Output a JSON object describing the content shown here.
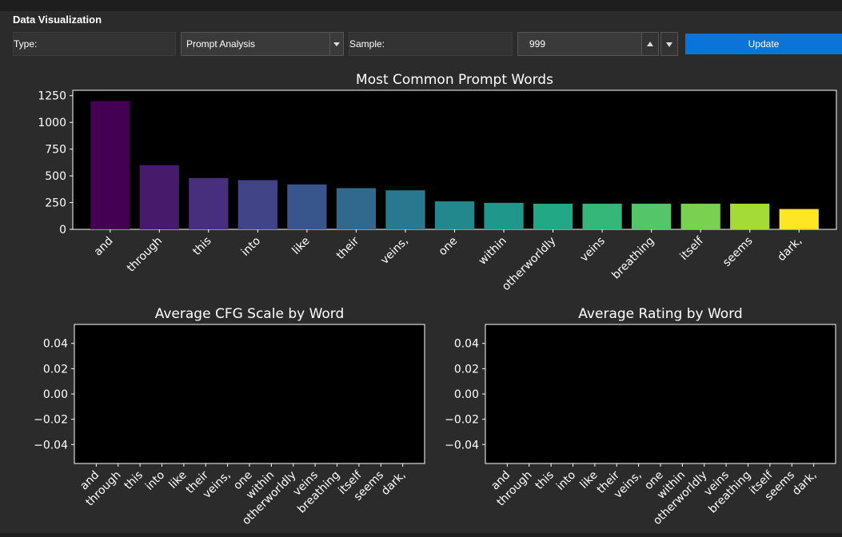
{
  "header": {
    "title": "Data Visualization"
  },
  "toolbar": {
    "type_label": "Type:",
    "type_value": "Prompt Analysis",
    "sample_label": "Sample:",
    "sample_value": "999",
    "update_label": "Update"
  },
  "chart_data": [
    {
      "type": "bar",
      "title": "Most Common Prompt Words",
      "categories": [
        "and",
        "through",
        "this",
        "into",
        "like",
        "their",
        "veins,",
        "one",
        "within",
        "otherworldly",
        "veins",
        "breathing",
        "itself",
        "seems",
        "dark,"
      ],
      "values": [
        1200,
        600,
        480,
        460,
        420,
        385,
        365,
        262,
        248,
        240,
        240,
        240,
        240,
        240,
        190
      ],
      "colors": [
        "#440154",
        "#481a6c",
        "#472f7d",
        "#414487",
        "#39568c",
        "#31688e",
        "#2a788e",
        "#23888e",
        "#1f988b",
        "#22a884",
        "#35b779",
        "#54c568",
        "#7ad151",
        "#a5db36",
        "#fde725"
      ],
      "ylim": [
        0,
        1300
      ],
      "yticks": [
        0,
        250,
        500,
        750,
        1000,
        1250
      ],
      "xlabel": "",
      "ylabel": "",
      "grid": false
    },
    {
      "type": "bar",
      "title": "Average CFG Scale by Word",
      "categories": [
        "and",
        "through",
        "this",
        "into",
        "like",
        "their",
        "veins,",
        "one",
        "within",
        "otherworldly",
        "veins",
        "breathing",
        "itself",
        "seems",
        "dark,"
      ],
      "values": [
        0,
        0,
        0,
        0,
        0,
        0,
        0,
        0,
        0,
        0,
        0,
        0,
        0,
        0,
        0
      ],
      "ylim": [
        -0.055,
        0.055
      ],
      "yticks": [
        "0.04",
        "0.02",
        "0.00",
        "−0.02",
        "−0.04"
      ],
      "xlabel": "",
      "ylabel": "",
      "grid": false
    },
    {
      "type": "bar",
      "title": "Average Rating by Word",
      "categories": [
        "and",
        "through",
        "this",
        "into",
        "like",
        "their",
        "veins,",
        "one",
        "within",
        "otherworldly",
        "veins",
        "breathing",
        "itself",
        "seems",
        "dark,"
      ],
      "values": [
        0,
        0,
        0,
        0,
        0,
        0,
        0,
        0,
        0,
        0,
        0,
        0,
        0,
        0,
        0
      ],
      "ylim": [
        -0.055,
        0.055
      ],
      "yticks": [
        "0.04",
        "0.02",
        "0.00",
        "−0.02",
        "−0.04"
      ],
      "xlabel": "",
      "ylabel": "",
      "grid": false
    }
  ]
}
